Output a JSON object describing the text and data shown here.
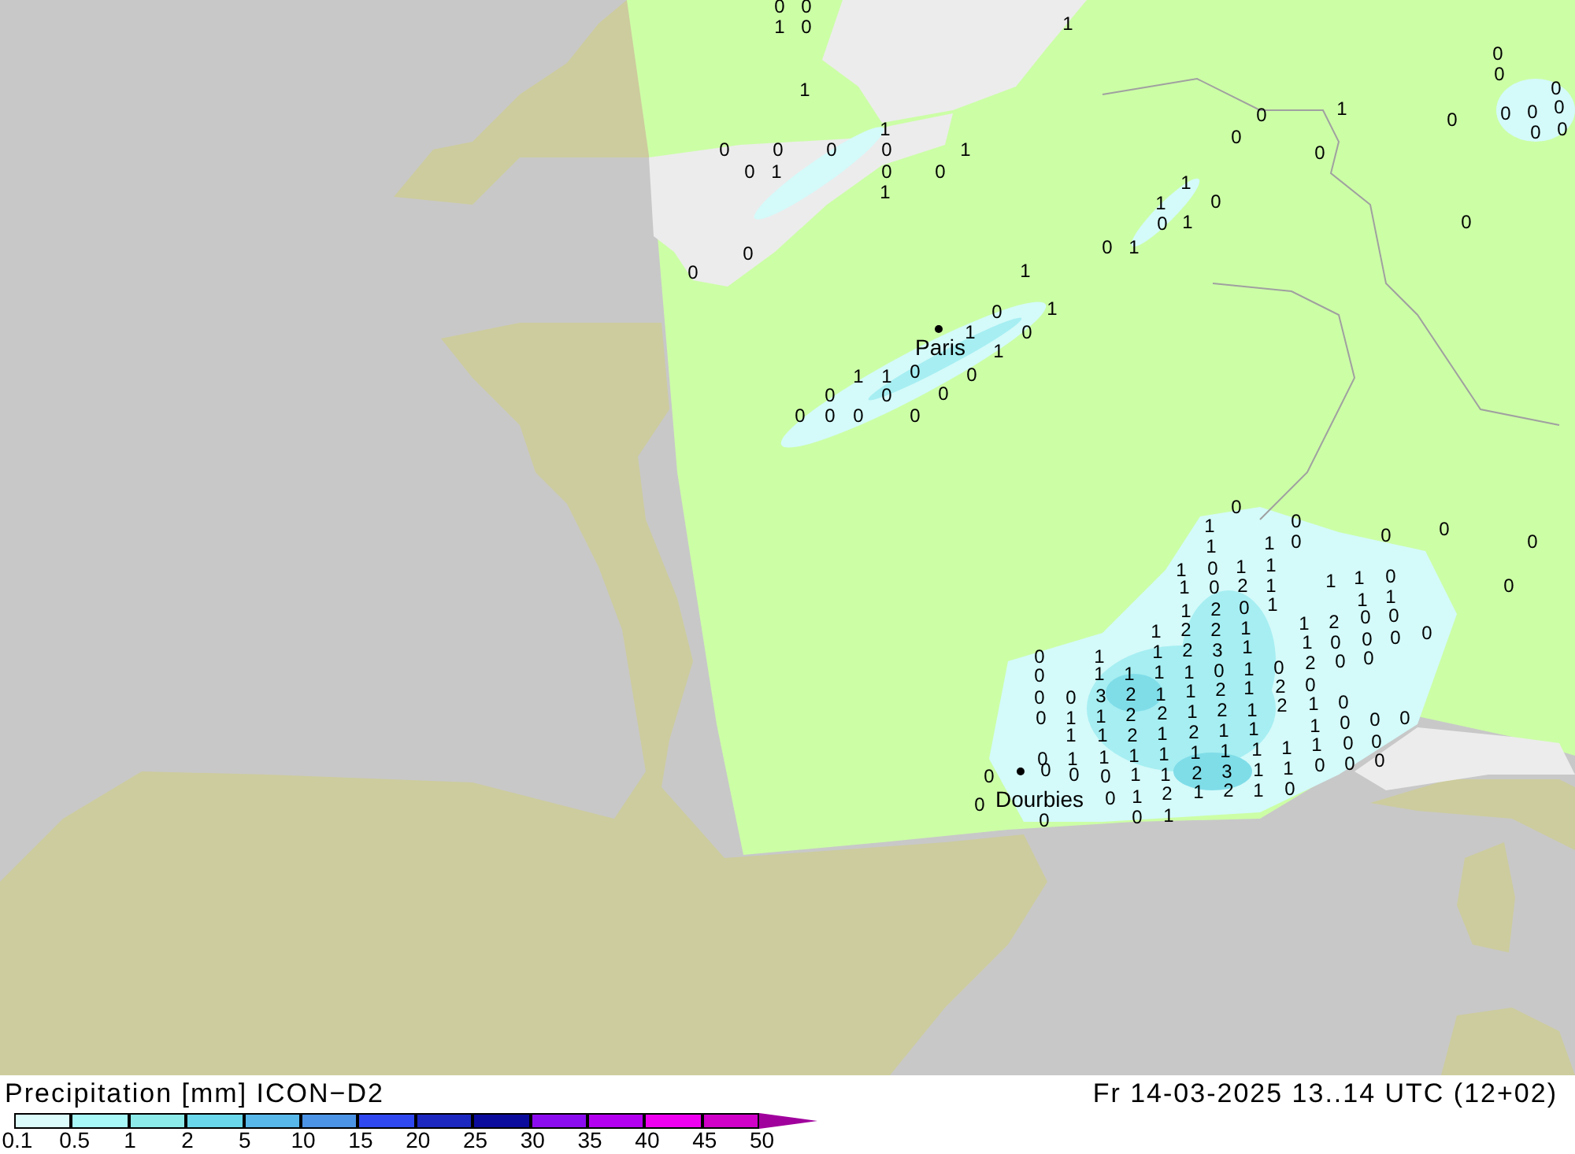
{
  "map": {
    "places": [
      {
        "name": "Paris"
      },
      {
        "name": "Dourbies"
      }
    ],
    "values": [
      "0",
      "0",
      "1",
      "0",
      "1",
      "0",
      "0",
      "0",
      "0",
      "0",
      "0",
      "0",
      "0",
      "0",
      "1",
      "0",
      "0",
      "0",
      "1",
      "1",
      "0",
      "0",
      "0",
      "0",
      "0",
      "1",
      "0",
      "0",
      "1",
      "1",
      "1",
      "0",
      "1",
      "0",
      "1",
      "0",
      "0",
      "0",
      "0",
      "1",
      "1",
      "0",
      "1",
      "1",
      "0",
      "1",
      "1",
      "1",
      "0",
      "0",
      "0",
      "0",
      "0",
      "0",
      "0",
      "0",
      "0",
      "0",
      "0",
      "0",
      "1",
      "0",
      "0",
      "0",
      "1",
      "1",
      "0",
      "1",
      "0",
      "1",
      "1",
      "1",
      "1",
      "0",
      "1",
      "0",
      "2",
      "1",
      "1",
      "1",
      "1",
      "2",
      "0",
      "1",
      "1",
      "2",
      "2",
      "1",
      "1",
      "2",
      "0",
      "0",
      "0",
      "1",
      "2",
      "3",
      "1",
      "1",
      "0",
      "0",
      "0",
      "0",
      "1",
      "2",
      "0",
      "0",
      "0",
      "1",
      "1",
      "1",
      "1",
      "0",
      "1",
      "0",
      "0",
      "0",
      "0",
      "3",
      "2",
      "1",
      "1",
      "2",
      "1",
      "2",
      "2",
      "1",
      "0",
      "0",
      "1",
      "1",
      "2",
      "2",
      "1",
      "2",
      "1",
      "1",
      "0",
      "0",
      "0",
      "1",
      "1",
      "2",
      "1",
      "2",
      "1",
      "1",
      "1",
      "0",
      "0",
      "0",
      "1",
      "1",
      "1",
      "1",
      "1",
      "1",
      "1",
      "1",
      "0",
      "0",
      "0",
      "0",
      "0",
      "0",
      "0",
      "1",
      "1",
      "2",
      "3",
      "1",
      "1",
      "0",
      "0",
      "1",
      "2",
      "1",
      "2",
      "1",
      "0",
      "0",
      "0",
      "1"
    ]
  },
  "legend": {
    "title": "Precipitation [mm] ICON−D2",
    "timestamp": "Fr 14-03-2025 13..14 UTC (12+02)",
    "boxes": [
      {
        "kind": "box",
        "color": "#dcfcfc"
      },
      {
        "kind": "box",
        "color": "#a8f8f8"
      },
      {
        "kind": "box",
        "color": "#8ceae8"
      },
      {
        "kind": "box",
        "color": "#6ad8ea"
      },
      {
        "kind": "box",
        "color": "#58b8ea"
      },
      {
        "kind": "box",
        "color": "#4c94e6"
      },
      {
        "kind": "box",
        "color": "#3048f0"
      },
      {
        "kind": "box",
        "color": "#1c28c0"
      },
      {
        "kind": "box",
        "color": "#0c0c9c"
      },
      {
        "kind": "box",
        "color": "#8c0cf0"
      },
      {
        "kind": "box",
        "color": "#b400f0"
      },
      {
        "kind": "box",
        "color": "#f000f0"
      },
      {
        "kind": "box",
        "color": "#d000c8"
      },
      {
        "kind": "arrow",
        "color": "#a0009c"
      }
    ],
    "ticks": [
      "0.1",
      "0.5",
      "1",
      "2",
      "5",
      "10",
      "15",
      "20",
      "25",
      "30",
      "35",
      "40",
      "45",
      "50"
    ]
  }
}
